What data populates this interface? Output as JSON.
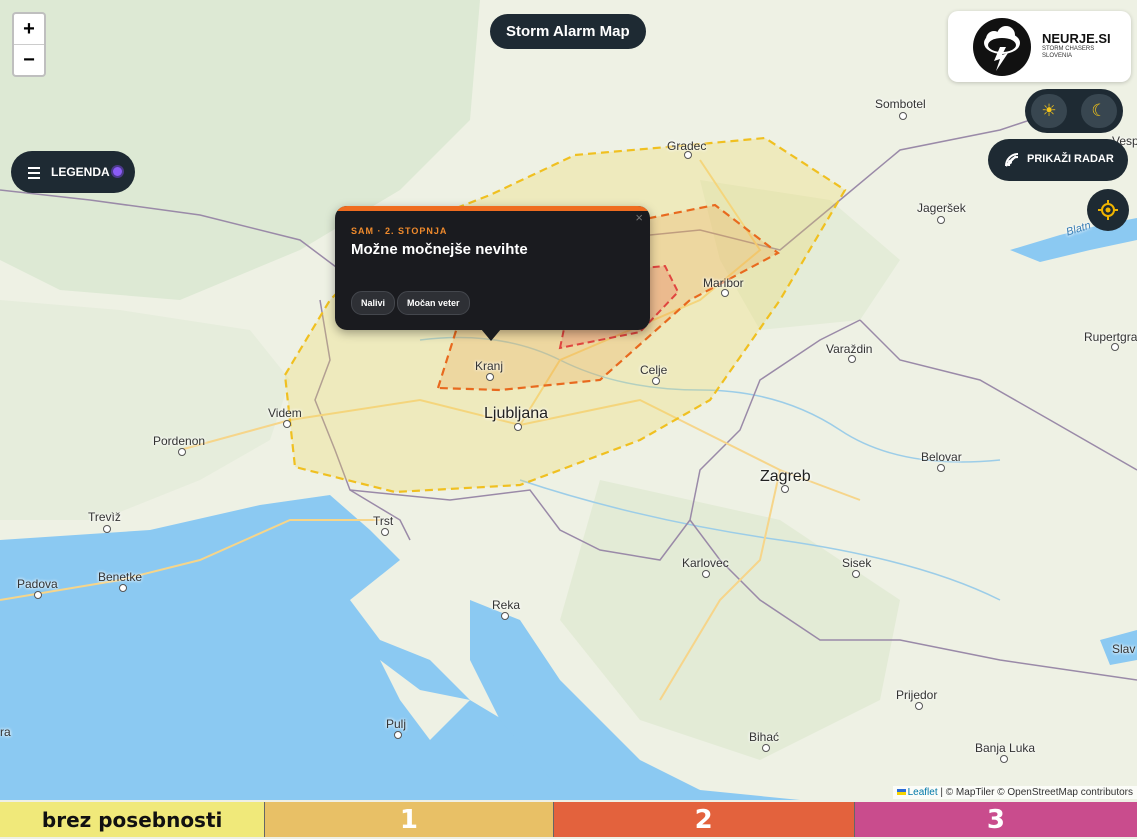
{
  "title": "Storm Alarm Map",
  "zoom": {
    "in_label": "+",
    "out_label": "−"
  },
  "legend_button": {
    "label": "LEGENDA"
  },
  "logo": {
    "brand": "NEURJE.SI",
    "tagline_1": "STORM CHASERS",
    "tagline_2": "SLOVENIA"
  },
  "theme": {
    "light_icon": "sun-icon",
    "dark_icon": "moon-icon"
  },
  "radar_button": {
    "label": "PRIKAŽI RADAR",
    "icon": "radar-icon"
  },
  "locate_button": {
    "icon": "crosshair-icon"
  },
  "popup": {
    "level": "SAM · 2. STOPNJA",
    "title": "Možne močnejše nevihte",
    "tags": [
      "Nalivi",
      "Močan veter"
    ],
    "close": "×"
  },
  "cities": [
    {
      "name": "Sombotel"
    },
    {
      "name": "Gradec"
    },
    {
      "name": "Jageršek"
    },
    {
      "name": "Vesp"
    },
    {
      "name": "Maribor"
    },
    {
      "name": "Rupertgra"
    },
    {
      "name": "Varaždin"
    },
    {
      "name": "Celje"
    },
    {
      "name": "Kranj"
    },
    {
      "name": "Ljubljana"
    },
    {
      "name": "Videm"
    },
    {
      "name": "Pordenon"
    },
    {
      "name": "Belovar"
    },
    {
      "name": "Zagreb"
    },
    {
      "name": "Trevìž"
    },
    {
      "name": "Trst"
    },
    {
      "name": "Padova"
    },
    {
      "name": "Benetke"
    },
    {
      "name": "Karlovec"
    },
    {
      "name": "Sisek"
    },
    {
      "name": "Reka"
    },
    {
      "name": "Slav"
    },
    {
      "name": "Prijedor"
    },
    {
      "name": "Pulj"
    },
    {
      "name": "Bihać"
    },
    {
      "name": "Banja Luka"
    },
    {
      "name": "ra"
    },
    {
      "name": "Blatn"
    }
  ],
  "attribution": {
    "leaflet": "Leaflet",
    "rest": " | © MapTiler © OpenStreetMap contributors"
  },
  "scale": [
    {
      "label": "brez posebnosti",
      "color": "#f0e97a"
    },
    {
      "label": "1",
      "color": "#e8c066"
    },
    {
      "label": "2",
      "color": "#e3623d"
    },
    {
      "label": "3",
      "color": "#c94c8d"
    }
  ]
}
